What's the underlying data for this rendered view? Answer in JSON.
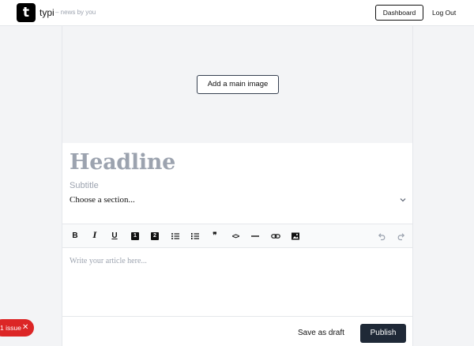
{
  "header": {
    "logo_letter": "t",
    "brand": "typi",
    "tagline": "– news by you",
    "dashboard_label": "Dashboard",
    "logout_label": "Log Out"
  },
  "editor": {
    "add_image_label": "Add a main image",
    "headline_placeholder": "Headline",
    "subtitle_placeholder": "Subtitle",
    "section_placeholder": "Choose a section...",
    "body_placeholder": "Write your article here...",
    "toolbar": [
      {
        "name": "bold-icon",
        "glyph": "B"
      },
      {
        "name": "italic-icon",
        "glyph": "I"
      },
      {
        "name": "underline-icon",
        "glyph": "U"
      },
      {
        "name": "heading-1-icon",
        "glyph": "1"
      },
      {
        "name": "heading-2-icon",
        "glyph": "2"
      },
      {
        "name": "bullet-list-icon",
        "glyph": ""
      },
      {
        "name": "numbered-list-icon",
        "glyph": ""
      },
      {
        "name": "quote-icon",
        "glyph": "❞"
      },
      {
        "name": "code-icon",
        "glyph": "<>"
      },
      {
        "name": "horizontal-rule-icon",
        "glyph": ""
      },
      {
        "name": "link-icon",
        "glyph": ""
      },
      {
        "name": "image-icon",
        "glyph": ""
      },
      {
        "name": "undo-icon",
        "glyph": ""
      },
      {
        "name": "redo-icon",
        "glyph": ""
      }
    ]
  },
  "actions": {
    "save_draft_label": "Save as draft",
    "publish_label": "Publish"
  },
  "issues": {
    "label": "1 issue",
    "close_glyph": "✕"
  },
  "colors": {
    "primary": "#1f2937",
    "danger": "#dc2626",
    "placeholder": "#9ca3af",
    "background": "#f3f4f6"
  }
}
